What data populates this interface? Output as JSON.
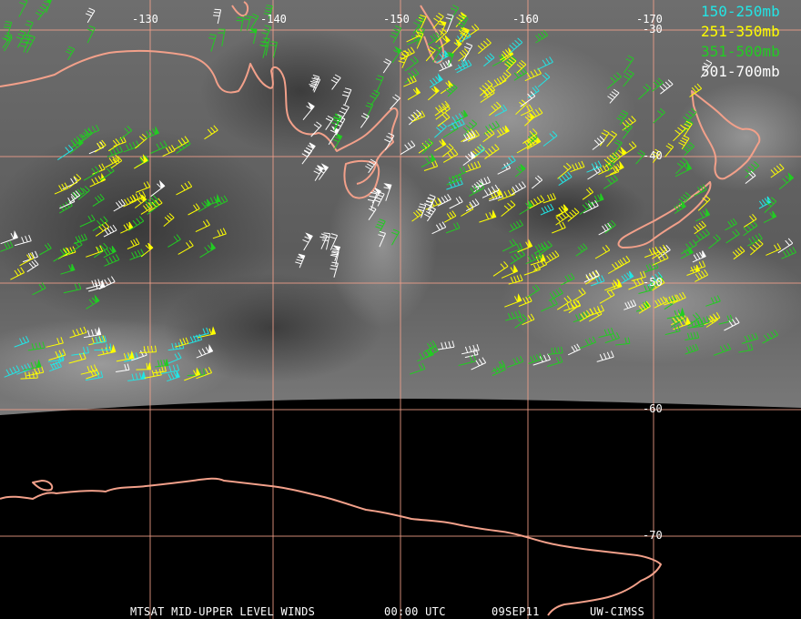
{
  "map": {
    "grid": {
      "longitude_labels": [
        "-130",
        "-140",
        "-150",
        "-160",
        "-170"
      ],
      "latitude_labels": [
        "-30",
        "-40",
        "-50",
        "-60",
        "-70"
      ],
      "line_color": "#f2a08a"
    },
    "coastline_color": "#f2a08a",
    "legend": [
      {
        "label": "150-250mb",
        "color": "#22e5e5"
      },
      {
        "label": "251-350mb",
        "color": "#ffff00"
      },
      {
        "label": "351-500mb",
        "color": "#22cc22"
      },
      {
        "label": "501-700mb",
        "color": "#ffffff"
      }
    ],
    "footer": {
      "product": "MTSAT MID-UPPER LEVEL WINDS",
      "time": "00:00 UTC",
      "date": "09SEP11",
      "source": "UW-CIMSS"
    }
  }
}
